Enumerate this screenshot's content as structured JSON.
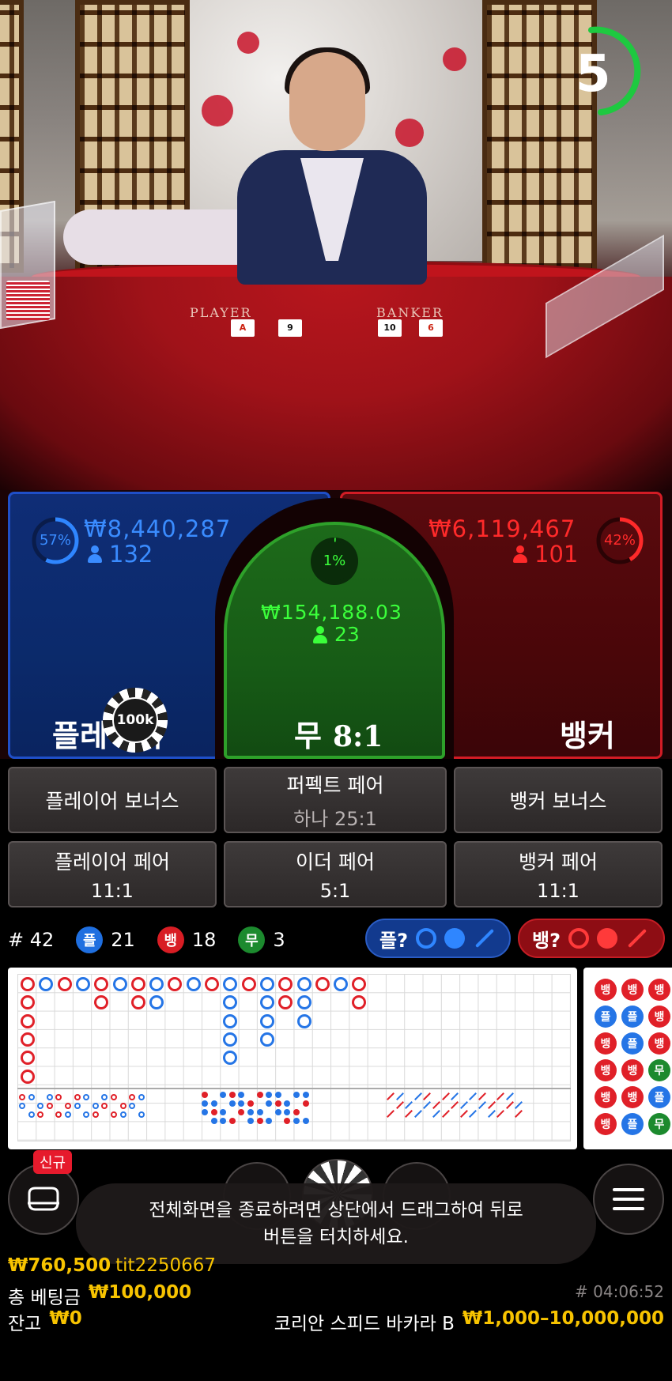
{
  "timer": {
    "value": "5",
    "color": "#1ec940"
  },
  "table_felt": {
    "player_label": "PLAYER",
    "banker_label": "BANKER",
    "player_cards": [
      "A",
      "9"
    ],
    "banker_cards": [
      "10",
      "6"
    ]
  },
  "player": {
    "percent": "57%",
    "amount": "₩8,440,287",
    "count": "132",
    "label": "플레이어",
    "color": "#3a8cff"
  },
  "tie": {
    "percent": "1%",
    "amount": "₩154,188.03",
    "count": "23",
    "label": "무",
    "odds": "8:1",
    "color": "#3bff3b"
  },
  "banker": {
    "percent": "42%",
    "amount": "₩6,119,467",
    "count": "101",
    "label": "뱅커",
    "color": "#ff2a2a"
  },
  "chip": {
    "value": "100k"
  },
  "side_bets": [
    {
      "line1": "플레이어 보너스",
      "line2": ""
    },
    {
      "line1": "퍼펙트 페어",
      "line2": "하나 25:1"
    },
    {
      "line1": "뱅커 보너스",
      "line2": ""
    },
    {
      "line1": "플레이어 페어",
      "line2": "11:1"
    },
    {
      "line1": "이더 페어",
      "line2": "5:1"
    },
    {
      "line1": "뱅커 페어",
      "line2": "11:1"
    }
  ],
  "stats": {
    "round_label": "# 42",
    "player_short": "플",
    "player_wins": "21",
    "banker_short": "뱅",
    "banker_wins": "18",
    "tie_short": "무",
    "tie_wins": "3"
  },
  "predict": {
    "player_label": "플?",
    "banker_label": "뱅?"
  },
  "bead_road": {
    "labels": [
      "뱅",
      "플",
      "뱅",
      "뱅",
      "뱅",
      "뱅",
      "뱅",
      "플",
      "플",
      "뱅",
      "뱅",
      "플",
      "뱅",
      "뱅",
      "뱅",
      "무",
      "플",
      "무"
    ]
  },
  "controls": {
    "new_badge": "신규",
    "toast": "전체화면을 종료하려면 상단에서 드래그하여 뒤로\n버튼을 터치하세요."
  },
  "footer": {
    "last_win": "₩760,500",
    "user_id": "tit2250667",
    "total_bet_label": "총 베팅금",
    "total_bet": "₩100,000",
    "balance_label": "잔고",
    "balance": "₩0",
    "game_id": "# 04:06:52",
    "table_name": "코리안 스피드 바카라 B",
    "limits": "₩1,000–10,000,000"
  }
}
